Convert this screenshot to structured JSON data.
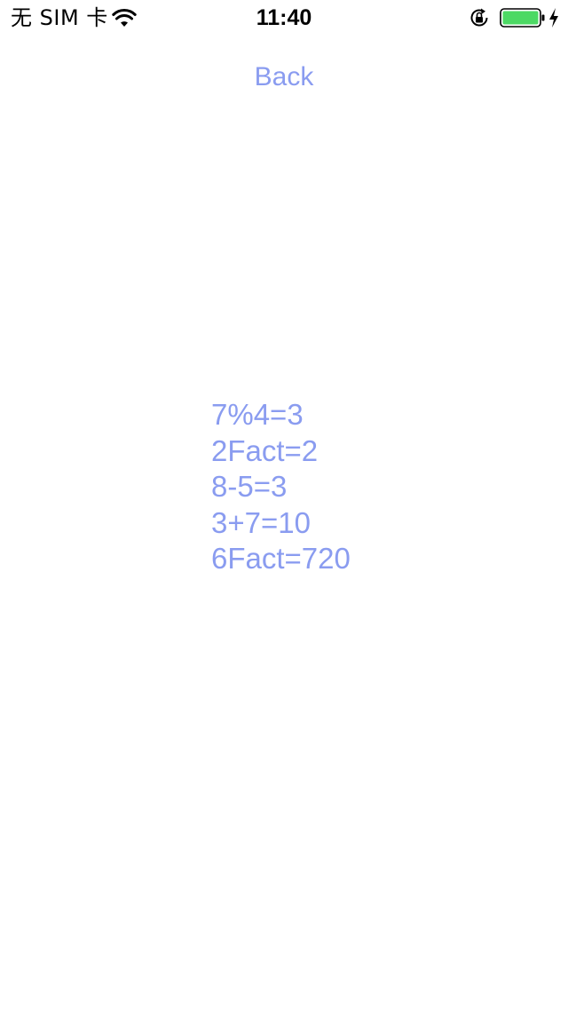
{
  "status_bar": {
    "carrier": "无 SIM 卡",
    "time": "11:40",
    "battery_color": "#4cd964"
  },
  "nav": {
    "back_label": "Back"
  },
  "results": [
    "7%4=3",
    "2Fact=2",
    "8-5=3",
    "3+7=10",
    "6Fact=720"
  ],
  "colors": {
    "accent": "#8a9cf0"
  },
  "icons": [
    "wifi-icon",
    "rotation-lock-icon",
    "battery-icon",
    "charging-icon"
  ]
}
